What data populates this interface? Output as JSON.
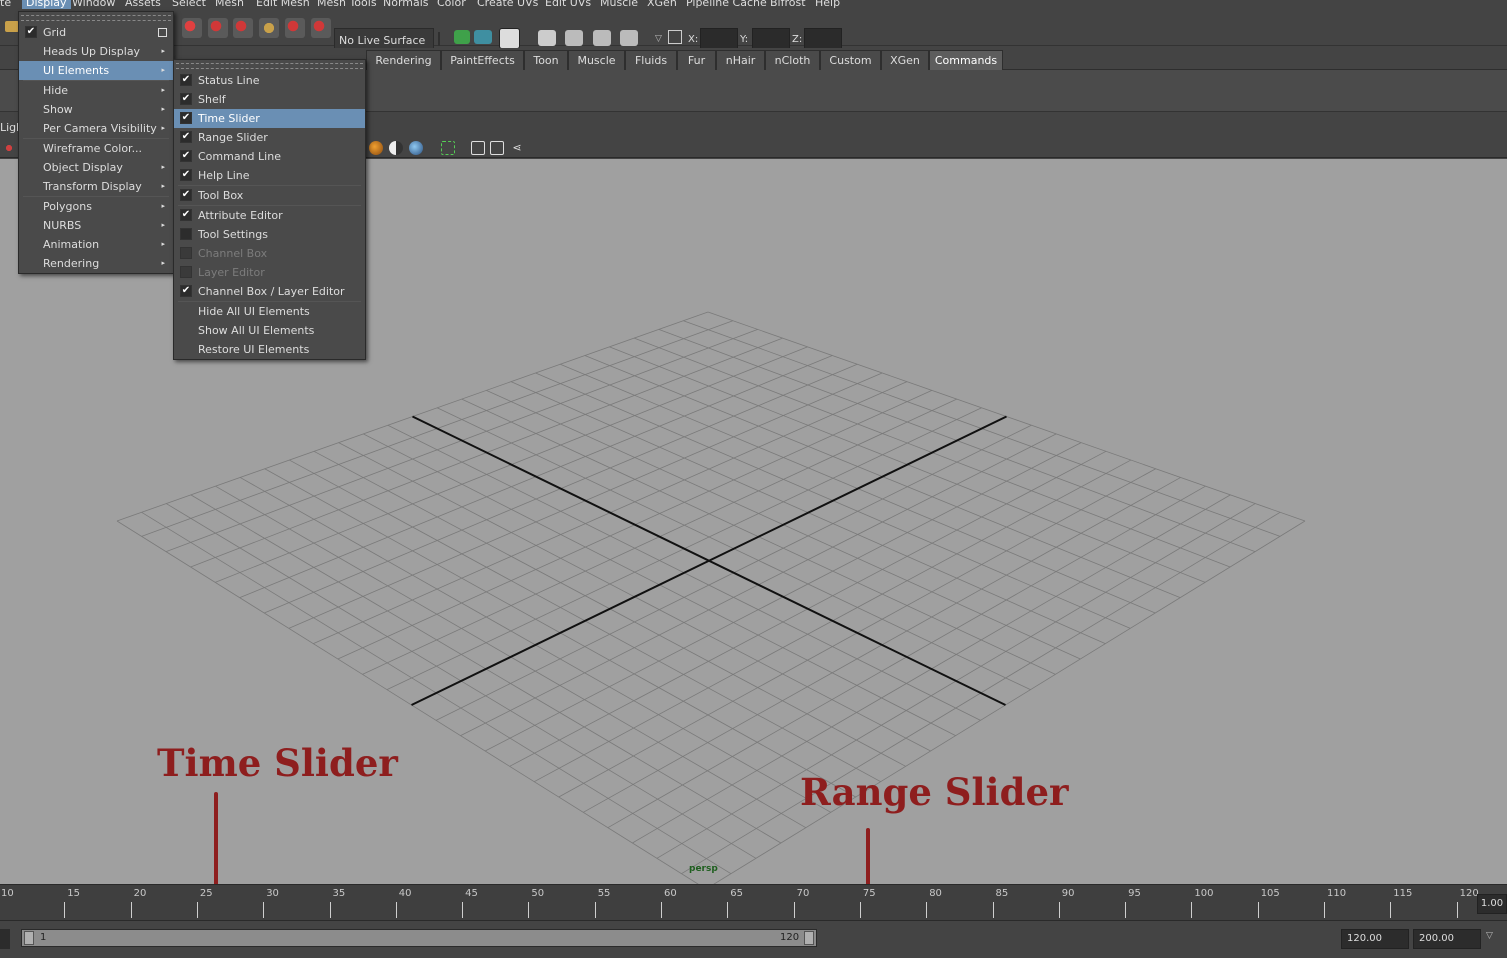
{
  "menubar": {
    "items": [
      "te",
      "Display",
      "Window",
      "Assets",
      "Select",
      "Mesh",
      "Edit Mesh",
      "Mesh Tools",
      "Normals",
      "Color",
      "Create UVs",
      "Edit UVs",
      "Muscle",
      "XGen",
      "Pipeline Cache",
      "Bifrost",
      "Help"
    ]
  },
  "statusline": {
    "live_surface": "No Live Surface",
    "x_label": "X:",
    "y_label": "Y:",
    "z_label": "Z:"
  },
  "shelf_tabs": {
    "items": [
      "Rendering",
      "PaintEffects",
      "Toon",
      "Muscle",
      "Fluids",
      "Fur",
      "nHair",
      "nCloth",
      "Custom",
      "XGen",
      "Commands"
    ],
    "active": "Commands"
  },
  "panel": {
    "lighting_label": "Ligh"
  },
  "display_menu": {
    "items": [
      {
        "label": "Grid",
        "checked": true,
        "option_box": true
      },
      {
        "label": "Heads Up Display",
        "submenu": true
      },
      {
        "label": "UI Elements",
        "submenu": true,
        "selected": true
      },
      {
        "separator": true
      },
      {
        "label": "Hide",
        "submenu": true
      },
      {
        "label": "Show",
        "submenu": true
      },
      {
        "label": "Per Camera Visibility",
        "submenu": true
      },
      {
        "separator": true
      },
      {
        "label": "Wireframe Color..."
      },
      {
        "label": "Object Display",
        "submenu": true
      },
      {
        "label": "Transform Display",
        "submenu": true
      },
      {
        "separator": true
      },
      {
        "label": "Polygons",
        "submenu": true
      },
      {
        "label": "NURBS",
        "submenu": true
      },
      {
        "label": "Animation",
        "submenu": true
      },
      {
        "label": "Rendering",
        "submenu": true
      }
    ]
  },
  "ui_elements_menu": {
    "items": [
      {
        "label": "Status Line",
        "checked": true
      },
      {
        "label": "Shelf",
        "checked": true
      },
      {
        "label": "Time Slider",
        "checked": true,
        "selected": true
      },
      {
        "label": "Range Slider",
        "checked": true
      },
      {
        "label": "Command Line",
        "checked": true
      },
      {
        "label": "Help Line",
        "checked": true
      },
      {
        "separator": true
      },
      {
        "label": "Tool Box",
        "checked": true
      },
      {
        "separator": true
      },
      {
        "label": "Attribute Editor",
        "checked": true
      },
      {
        "label": "Tool Settings",
        "checked": false
      },
      {
        "label": "Channel Box",
        "checked": false,
        "disabled": true
      },
      {
        "label": "Layer Editor",
        "checked": false,
        "disabled": true
      },
      {
        "label": "Channel Box / Layer Editor",
        "checked": true
      },
      {
        "separator": true
      },
      {
        "label": "Hide All UI Elements"
      },
      {
        "label": "Show All UI Elements"
      },
      {
        "label": "Restore UI Elements"
      }
    ]
  },
  "viewport": {
    "camera": "persp"
  },
  "annotations": {
    "time_slider": "Time Slider",
    "range_slider": "Range Slider"
  },
  "time_slider": {
    "ticks": [
      "10",
      "15",
      "20",
      "25",
      "30",
      "35",
      "40",
      "45",
      "50",
      "55",
      "60",
      "65",
      "70",
      "75",
      "80",
      "85",
      "90",
      "95",
      "100",
      "105",
      "110",
      "115",
      "120"
    ],
    "current_frame": "1.00"
  },
  "range_slider": {
    "start": "1",
    "end": "120",
    "playback_end": "120.00",
    "anim_end": "200.00"
  },
  "colors": {
    "accent": "#6a8fb4",
    "annotation": "#8e1e1e",
    "viewport_bg": "#a0a0a0"
  }
}
